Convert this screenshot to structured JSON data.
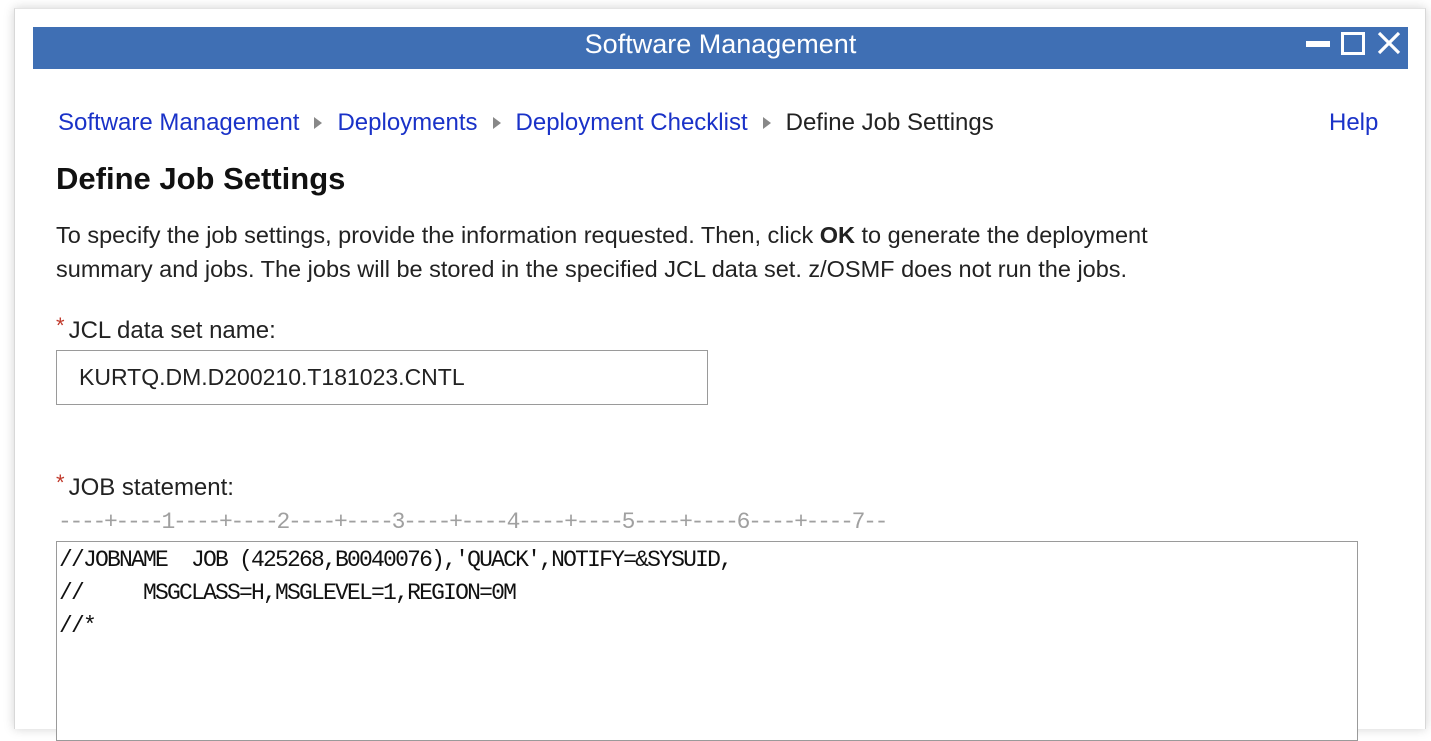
{
  "window": {
    "title": "Software Management",
    "controls": {
      "minimize_icon": "minimize-icon",
      "maximize_icon": "maximize-icon",
      "close_icon": "close-icon"
    },
    "titlebar_color": "#3f6fb4"
  },
  "breadcrumb": {
    "items": [
      {
        "label": "Software Management",
        "link": true
      },
      {
        "label": "Deployments",
        "link": true
      },
      {
        "label": "Deployment Checklist",
        "link": true
      },
      {
        "label": "Define Job Settings",
        "link": false
      }
    ],
    "separator_icon": "triangle-right-icon"
  },
  "help_label": "Help",
  "page_title": "Define Job Settings",
  "intro": {
    "before_bold": "To specify the job settings, provide the information requested. Then, click ",
    "bold": "OK",
    "line1_after": " to generate the deployment",
    "line2": "summary and jobs. The jobs will be stored in the specified JCL data set. z/OSMF does not run the jobs."
  },
  "required_marker": "*",
  "jcl_field": {
    "label": "JCL data set name:",
    "value": "KURTQ.DM.D200210.T181023.CNTL"
  },
  "job_field": {
    "label": "JOB statement:",
    "ruler": "----+----1----+----2----+----3----+----4----+----5----+----6----+----7--",
    "lines": [
      "//JOBNAME  JOB (425268,B0040076),'QUACK',NOTIFY=&SYSUID,",
      "//     MSGCLASS=H,MSGLEVEL=1,REGION=0M",
      "//*"
    ]
  },
  "colors": {
    "link": "#1a32c8",
    "required": "#c0392b",
    "ruler": "#a0a0a0"
  }
}
